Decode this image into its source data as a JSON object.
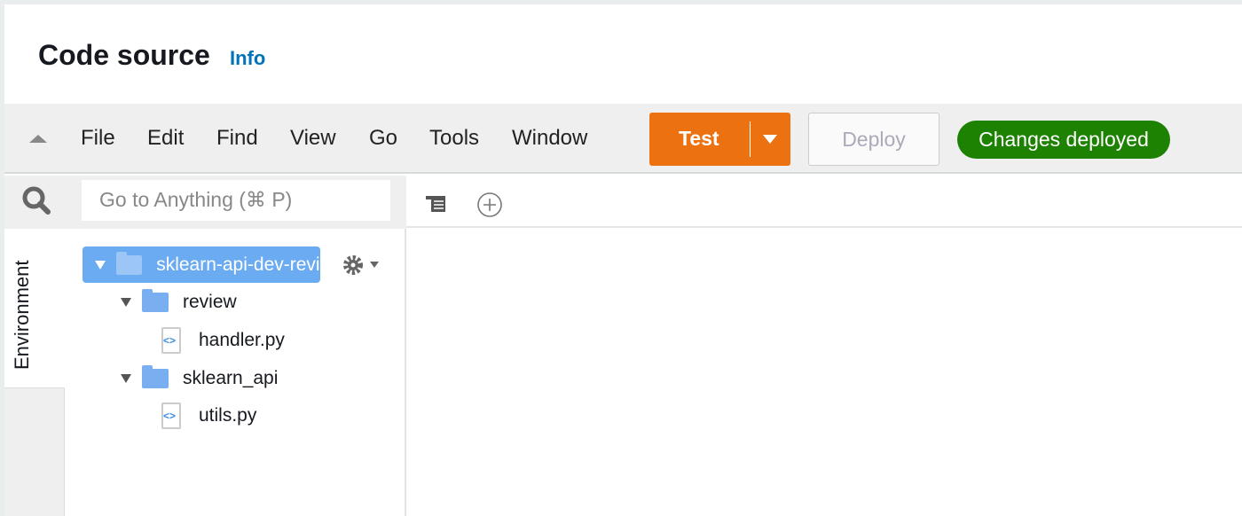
{
  "header": {
    "title": "Code source",
    "info_link": "Info"
  },
  "toolbar": {
    "menus": [
      "File",
      "Edit",
      "Find",
      "View",
      "Go",
      "Tools",
      "Window"
    ],
    "test_label": "Test",
    "deploy_label": "Deploy",
    "status_badge": "Changes deployed",
    "accent": "#ec7211",
    "status_color": "#1d8102"
  },
  "search": {
    "placeholder": "Go to Anything (⌘ P)"
  },
  "sidebar": {
    "tab": "Environment"
  },
  "tree": {
    "root": "sklearn-api-dev-revi",
    "items": [
      {
        "label": "review",
        "type": "folder"
      },
      {
        "label": "handler.py",
        "type": "file"
      },
      {
        "label": "sklearn_api",
        "type": "folder"
      },
      {
        "label": "utils.py",
        "type": "file"
      }
    ]
  }
}
